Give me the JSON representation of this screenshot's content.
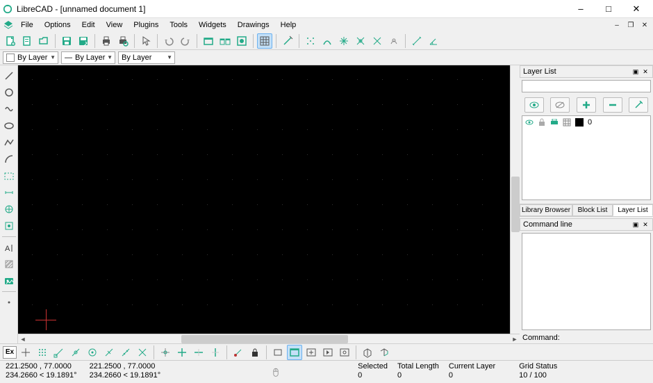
{
  "window": {
    "title": "LibreCAD - [unnamed document 1]"
  },
  "menu": {
    "items": [
      "File",
      "Options",
      "Edit",
      "View",
      "Plugins",
      "Tools",
      "Widgets",
      "Drawings",
      "Help"
    ]
  },
  "layer_combo": {
    "a": "By Layer",
    "b": "By Layer",
    "c": "By Layer"
  },
  "right": {
    "layer_list_title": "Layer List",
    "layer0": "0",
    "tabs": {
      "lib": "Library Browser",
      "blk": "Block List",
      "lay": "Layer List"
    },
    "cmd_title": "Command line",
    "cmd_label": "Command:"
  },
  "bottom_toolbar": {
    "ex": "Ex"
  },
  "status": {
    "coord1": "221.2500 , 77.0000",
    "coord1b": "234.2660 < 19.1891°",
    "coord2": "221.2500 , 77.0000",
    "coord2b": "234.2660 < 19.1891°",
    "sel_h": "Selected",
    "sel_v": "0",
    "len_h": "Total Length",
    "len_v": "0",
    "cur_h": "Current Layer",
    "cur_v": "0",
    "grid_h": "Grid Status",
    "grid_v": "10 / 100"
  }
}
